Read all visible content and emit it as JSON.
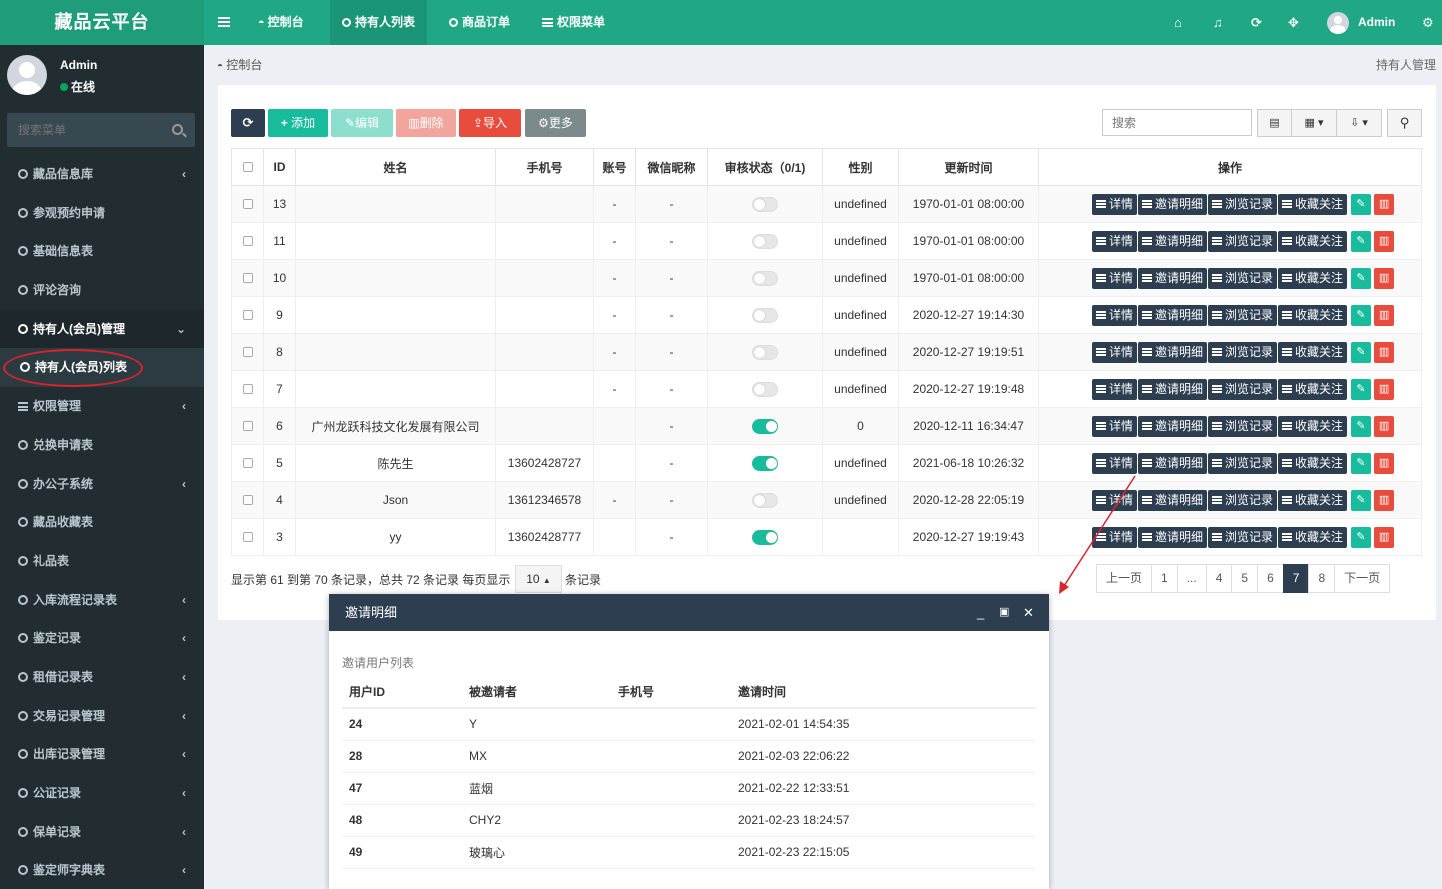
{
  "app": {
    "title": "藏品云平台"
  },
  "user": {
    "name": "Admin",
    "status": "在线"
  },
  "sidebar": {
    "search_placeholder": "搜索菜单",
    "items": [
      {
        "label": "藏品信息库",
        "icon": "circle-icon",
        "chevron": "‹"
      },
      {
        "label": "参观预约申请",
        "icon": "circle-icon",
        "chevron": ""
      },
      {
        "label": "基础信息表",
        "icon": "circle-icon",
        "chevron": ""
      },
      {
        "label": "评论咨询",
        "icon": "circle-icon",
        "chevron": ""
      },
      {
        "label": "持有人(会员)管理",
        "icon": "circle-icon",
        "chevron": "⌄"
      },
      {
        "label": "持有人(会员)列表",
        "icon": "circle-icon",
        "chevron": ""
      },
      {
        "label": "权限管理",
        "icon": "list-icon",
        "chevron": "‹"
      },
      {
        "label": "兑换申请表",
        "icon": "circle-icon",
        "chevron": ""
      },
      {
        "label": "办公子系统",
        "icon": "circle-icon",
        "chevron": "‹"
      },
      {
        "label": "藏品收藏表",
        "icon": "circle-icon",
        "chevron": ""
      },
      {
        "label": "礼品表",
        "icon": "circle-icon",
        "chevron": ""
      },
      {
        "label": "入库流程记录表",
        "icon": "circle-icon",
        "chevron": "‹"
      },
      {
        "label": "鉴定记录",
        "icon": "circle-icon",
        "chevron": "‹"
      },
      {
        "label": "租借记录表",
        "icon": "circle-icon",
        "chevron": "‹"
      },
      {
        "label": "交易记录管理",
        "icon": "circle-icon",
        "chevron": "‹"
      },
      {
        "label": "出库记录管理",
        "icon": "circle-icon",
        "chevron": "‹"
      },
      {
        "label": "公证记录",
        "icon": "circle-icon",
        "chevron": "‹"
      },
      {
        "label": "保单记录",
        "icon": "circle-icon",
        "chevron": "‹"
      },
      {
        "label": "鉴定师字典表",
        "icon": "circle-icon",
        "chevron": "‹"
      }
    ]
  },
  "topnav": {
    "tabs": [
      {
        "label": "控制台",
        "icon": "dashboard-icon"
      },
      {
        "label": "持有人列表",
        "icon": "circle-icon"
      },
      {
        "label": "商品订单",
        "icon": "circle-icon"
      },
      {
        "label": "权限菜单",
        "icon": "list-icon"
      }
    ],
    "right_icons": [
      "home-icon",
      "bell-icon",
      "refresh-icon",
      "fullscreen-icon",
      "settings-icon"
    ],
    "user": "Admin"
  },
  "breadcrumb": {
    "left": "控制台",
    "right": "持有人管理"
  },
  "toolbar": {
    "refresh": "",
    "add": "添加",
    "edit": "编辑",
    "delete": "删除",
    "import": "导入",
    "more": "更多",
    "search_placeholder": "搜索",
    "colors": {
      "dark": "#2c3e50",
      "success": "#18bc9c",
      "danger": "#e74c3c"
    }
  },
  "table": {
    "columns": [
      "",
      "ID",
      "姓名",
      "手机号",
      "账号",
      "微信昵称",
      "审核状态（0/1)",
      "性别",
      "更新时间",
      "操作"
    ],
    "ops": [
      "详情",
      "邀请明细",
      "浏览记录",
      "收藏关注"
    ],
    "rows": [
      {
        "id": "13",
        "name": "",
        "phone": "",
        "account": "-",
        "wechat": "-",
        "status": false,
        "gender": "undefined",
        "updated": "1970-01-01 08:00:00"
      },
      {
        "id": "11",
        "name": "",
        "phone": "",
        "account": "-",
        "wechat": "-",
        "status": false,
        "gender": "undefined",
        "updated": "1970-01-01 08:00:00"
      },
      {
        "id": "10",
        "name": "",
        "phone": "",
        "account": "-",
        "wechat": "-",
        "status": false,
        "gender": "undefined",
        "updated": "1970-01-01 08:00:00"
      },
      {
        "id": "9",
        "name": "",
        "phone": "",
        "account": "-",
        "wechat": "-",
        "status": false,
        "gender": "undefined",
        "updated": "2020-12-27 19:14:30"
      },
      {
        "id": "8",
        "name": "",
        "phone": "",
        "account": "-",
        "wechat": "-",
        "status": false,
        "gender": "undefined",
        "updated": "2020-12-27 19:19:51"
      },
      {
        "id": "7",
        "name": "",
        "phone": "",
        "account": "-",
        "wechat": "-",
        "status": false,
        "gender": "undefined",
        "updated": "2020-12-27 19:19:48"
      },
      {
        "id": "6",
        "name": "广州龙跃科技文化发展有限公司",
        "phone": "",
        "account": "",
        "wechat": "-",
        "status": true,
        "gender": "0",
        "updated": "2020-12-11 16:34:47"
      },
      {
        "id": "5",
        "name": "陈先生",
        "phone": "13602428727",
        "account": "",
        "wechat": "-",
        "status": true,
        "gender": "undefined",
        "updated": "2021-06-18 10:26:32"
      },
      {
        "id": "4",
        "name": "Json",
        "phone": "13612346578",
        "account": "-",
        "wechat": "-",
        "status": false,
        "gender": "undefined",
        "updated": "2020-12-28 22:05:19"
      },
      {
        "id": "3",
        "name": "yy",
        "phone": "13602428777",
        "account": "",
        "wechat": "-",
        "status": true,
        "gender": "",
        "updated": "2020-12-27 19:19:43"
      }
    ]
  },
  "pagination": {
    "info": "显示第 61 到第 70 条记录，总共 72 条记录 每页显示",
    "page_size": "10",
    "suffix": "条记录",
    "pages": [
      "上一页",
      "1",
      "...",
      "4",
      "5",
      "6",
      "7",
      "8",
      "下一页"
    ],
    "current": "7"
  },
  "modal": {
    "title": "邀请明细",
    "subtitle": "邀请用户列表",
    "columns": [
      "用户ID",
      "被邀请者",
      "手机号",
      "邀请时间"
    ],
    "rows": [
      {
        "uid": "24",
        "invitee": "Y",
        "phone": "",
        "time": "2021-02-01 14:54:35"
      },
      {
        "uid": "28",
        "invitee": "MX",
        "phone": "",
        "time": "2021-02-03 22:06:22"
      },
      {
        "uid": "47",
        "invitee": "蓝烟",
        "phone": "",
        "time": "2021-02-22 12:33:51"
      },
      {
        "uid": "48",
        "invitee": "CHY2",
        "phone": "",
        "time": "2021-02-23 18:24:57"
      },
      {
        "uid": "49",
        "invitee": "玻璃心",
        "phone": "",
        "time": "2021-02-23 22:15:05"
      }
    ]
  },
  "annotation": {
    "color": "#d9232d"
  }
}
